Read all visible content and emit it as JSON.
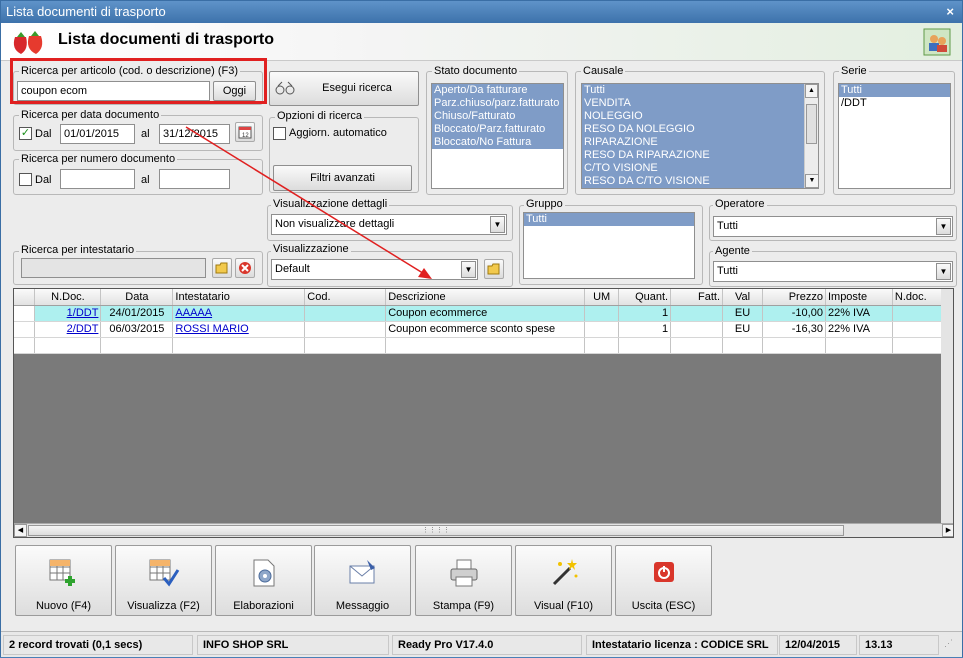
{
  "window": {
    "title": "Lista documenti di trasporto",
    "close_glyph": "×"
  },
  "header": {
    "title": "Lista documenti di trasporto",
    "logo_icon": "strawberry-icon",
    "user_icon": "users-icon"
  },
  "search_article": {
    "label": "Ricerca per articolo (cod. o descrizione) (F3)",
    "value": "coupon ecom",
    "ok_label": "Oggi"
  },
  "search_date": {
    "label": "Ricerca per data documento",
    "dal_label": "Dal",
    "from": "01/01/2015",
    "al_label": "al",
    "to": "31/12/2015",
    "checked": true
  },
  "search_number": {
    "label": "Ricerca per numero documento",
    "dal_label": "Dal",
    "al_label": "al",
    "from": "",
    "to": ""
  },
  "search_button": "Esegui ricerca",
  "options": {
    "label": "Opzioni di ricerca",
    "auto_update": "Aggiorn. automatico",
    "advanced": "Filtri avanzati"
  },
  "stato": {
    "label": "Stato documento",
    "items": [
      "Aperto/Da fatturare",
      "Parz.chiuso/parz.fatturato",
      "Chiuso/Fatturato",
      "Bloccato/Parz.fatturato",
      "Bloccato/No Fattura"
    ]
  },
  "causale": {
    "label": "Causale",
    "items": [
      "Tutti",
      "VENDITA",
      "NOLEGGIO",
      "RESO DA NOLEGGIO",
      "RIPARAZIONE",
      "RESO DA RIPARAZIONE",
      "C/TO VISIONE",
      "RESO DA C/TO VISIONE"
    ]
  },
  "serie": {
    "label": "Serie",
    "items": [
      "Tutti",
      "/DDT"
    ]
  },
  "dettagli": {
    "label": "Visualizzazione dettagli",
    "value": "Non visualizzare dettagli"
  },
  "gruppo": {
    "label": "Gruppo",
    "items": [
      "Tutti"
    ]
  },
  "operatore": {
    "label": "Operatore",
    "value": "Tutti"
  },
  "intestatario": {
    "label": "Ricerca per intestatario",
    "value": ""
  },
  "visualizzazione": {
    "label": "Visualizzazione",
    "value": "Default"
  },
  "agente": {
    "label": "Agente",
    "value": "Tutti"
  },
  "grid": {
    "columns": [
      "",
      "N.Doc.",
      "Data",
      "Intestatario",
      "Cod.",
      "Descrizione",
      "UM",
      "Quant.",
      "Fatt.",
      "Val",
      "Prezzo",
      "Imposte",
      "N.doc."
    ],
    "rows": [
      {
        "ndoc": "1/DDT",
        "data": "24/01/2015",
        "intestatario": "AAAAA",
        "cod": "",
        "descrizione": "Coupon ecommerce",
        "um": "",
        "quant": "1",
        "fatt": "",
        "val": "EU",
        "prezzo": "-10,00",
        "imposte": "22% IVA",
        "ndoc2": ""
      },
      {
        "ndoc": "2/DDT",
        "data": "06/03/2015",
        "intestatario": "ROSSI MARIO",
        "cod": "",
        "descrizione": "Coupon ecommerce sconto spese",
        "um": "",
        "quant": "1",
        "fatt": "",
        "val": "EU",
        "prezzo": "-16,30",
        "imposte": "22% IVA",
        "ndoc2": ""
      }
    ]
  },
  "toolbar": {
    "nuovo": "Nuovo (F4)",
    "visualizza": "Visualizza (F2)",
    "elaborazioni": "Elaborazioni",
    "messaggio": "Messaggio",
    "stampa": "Stampa (F9)",
    "visual": "Visual (F10)",
    "uscita": "Uscita (ESC)"
  },
  "status": {
    "records": "2 record trovati (0,1 secs)",
    "company": "INFO SHOP SRL",
    "version": "Ready Pro V17.4.0",
    "license": "Intestatario licenza : CODICE SRL",
    "date": "12/04/2015",
    "time": "13.13"
  },
  "colors": {
    "highlight_row": "#aef0ef",
    "selection": "#7f9cc7",
    "annotation": "#e02020"
  }
}
